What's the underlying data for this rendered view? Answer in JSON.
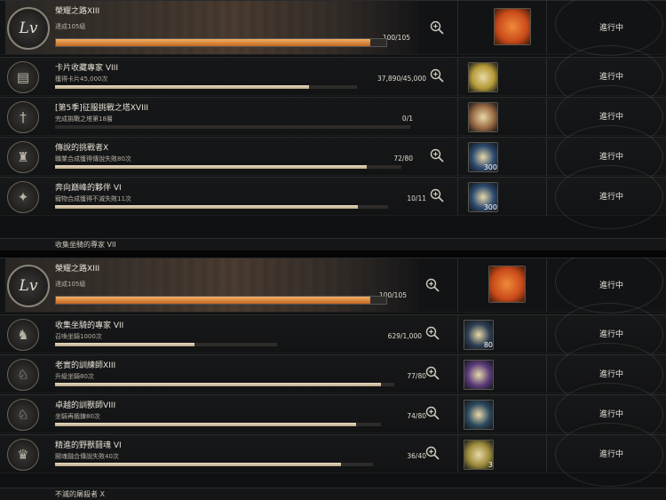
{
  "common": {
    "status_label": "進行中"
  },
  "panels": [
    {
      "banner": {
        "title": "榮耀之路XIII",
        "subtitle": "達成105級",
        "progress_text": "100/105",
        "progress_fraction": 0.952,
        "reward_color": "#c94a1a"
      },
      "rows": [
        {
          "icon": "card-icon",
          "title": "卡片收藏專家 VIII",
          "subtitle": "獲得卡片45,000次",
          "progress_text": "37,890/45,000",
          "progress_fraction": 0.842,
          "show_mag": true,
          "reward_color": "#b59a37",
          "reward_count": ""
        },
        {
          "icon": "sword-icon",
          "title": "[第5季]征服挑戰之塔XVIII",
          "subtitle": "完成挑戰之塔第18層",
          "progress_text": "0/1",
          "progress_fraction": 0.0,
          "show_mag": false,
          "reward_color": "#9a6a44",
          "reward_count": ""
        },
        {
          "icon": "helmet-icon",
          "title": "傳說的挑戰者X",
          "subtitle": "職業合成獲得傳說失敗80次",
          "progress_text": "72/80",
          "progress_fraction": 0.9,
          "show_mag": true,
          "reward_color": "#2e4a6e",
          "reward_count": "300"
        },
        {
          "icon": "companion-icon",
          "title": "奔向巔峰的夥伴 VI",
          "subtitle": "寵物合成獲得不滅失敗11次",
          "progress_text": "10/11",
          "progress_fraction": 0.909,
          "show_mag": true,
          "reward_color": "#2e4a6e",
          "reward_count": "300"
        }
      ],
      "peek_text": "收集坐騎的專家 VII"
    },
    {
      "banner": {
        "title": "榮耀之路XIII",
        "subtitle": "達成105級",
        "progress_text": "100/105",
        "progress_fraction": 0.952,
        "reward_color": "#c94a1a"
      },
      "rows": [
        {
          "icon": "mount-icon",
          "title": "收集坐騎的專家 VII",
          "subtitle": "召喚坐騎1000次",
          "progress_text": "629/1,000",
          "progress_fraction": 0.629,
          "show_mag": true,
          "reward_color": "#2d3e52",
          "reward_count": "80"
        },
        {
          "icon": "horse-icon",
          "title": "老實的訓練師XIII",
          "subtitle": "升級坐騎80次",
          "progress_text": "77/80",
          "progress_fraction": 0.962,
          "show_mag": true,
          "reward_color": "#5c3c7a",
          "reward_count": ""
        },
        {
          "icon": "horse-icon",
          "title": "卓越的訓獸師VIII",
          "subtitle": "坐騎再鍛鍊80次",
          "progress_text": "74/80",
          "progress_fraction": 0.925,
          "show_mag": true,
          "reward_color": "#2d4a5e",
          "reward_count": ""
        },
        {
          "icon": "beast-icon",
          "title": "精進的野獸鬪魂 VI",
          "subtitle": "鬪魂融合傳說失敗40次",
          "progress_text": "36/40",
          "progress_fraction": 0.9,
          "show_mag": true,
          "reward_color": "#9b8a3a",
          "reward_count": "3"
        }
      ],
      "peek_text": "不滅的屠殺者 X"
    }
  ]
}
